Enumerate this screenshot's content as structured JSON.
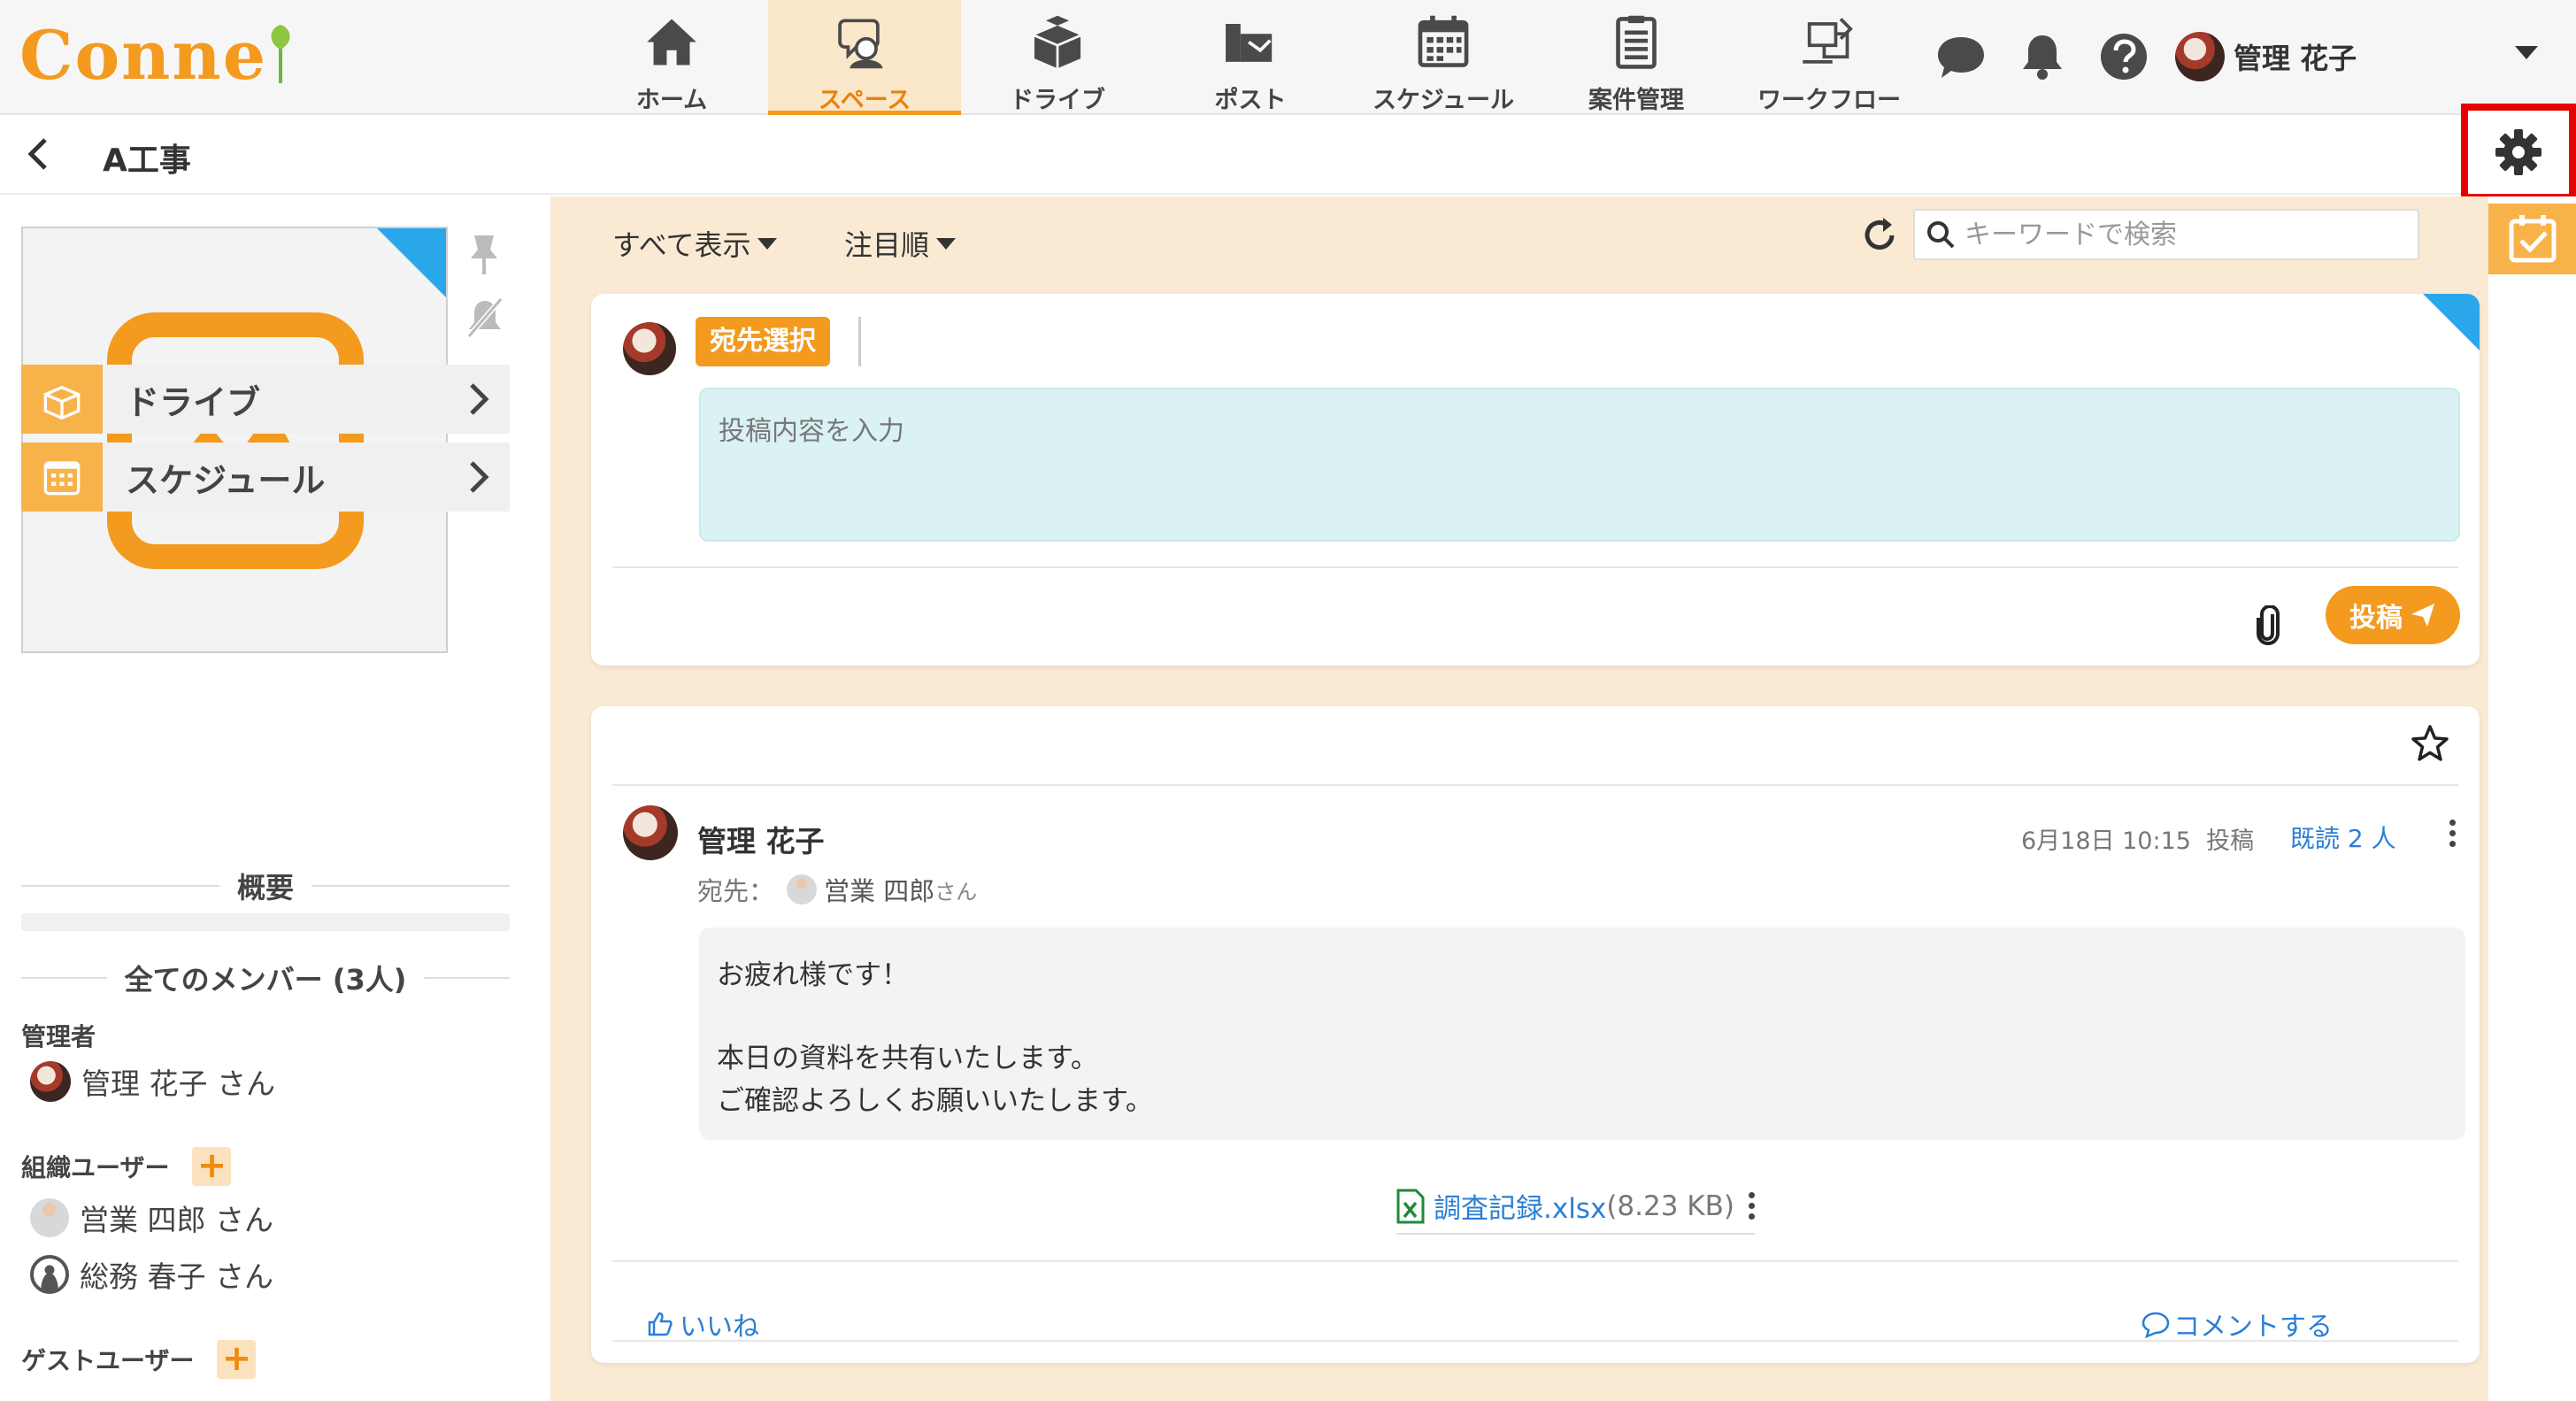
{
  "app": {
    "logo_text": "Conne"
  },
  "nav": {
    "items": [
      {
        "label": "ホーム",
        "icon": "home-icon"
      },
      {
        "label": "スペース",
        "icon": "space-icon"
      },
      {
        "label": "ドライブ",
        "icon": "drive-icon"
      },
      {
        "label": "ポスト",
        "icon": "post-icon"
      },
      {
        "label": "スケジュール",
        "icon": "calendar-icon"
      },
      {
        "label": "案件管理",
        "icon": "clipboard-icon"
      },
      {
        "label": "ワークフロー",
        "icon": "workflow-icon"
      }
    ],
    "active_index": 1
  },
  "header": {
    "user_name": "管理 花子"
  },
  "space": {
    "title": "A工事"
  },
  "left": {
    "menu": [
      {
        "label": "ドライブ",
        "icon": "drive-icon"
      },
      {
        "label": "スケジュール",
        "icon": "calendar-icon"
      }
    ],
    "summary_title": "概要",
    "members_title": "全てのメンバー (3人)",
    "roles": {
      "admin": {
        "label": "管理者",
        "members": [
          "管理 花子 さん"
        ]
      },
      "org": {
        "label": "組織ユーザー",
        "members": [
          "営業 四郎 さん",
          "総務 春子 さん"
        ]
      },
      "guest": {
        "label": "ゲストユーザー",
        "members": []
      }
    },
    "plus": "+"
  },
  "filters": {
    "display": "すべて表示",
    "sort": "注目順"
  },
  "search": {
    "placeholder": "キーワードで検索",
    "value": ""
  },
  "compose": {
    "to_button": "宛先選択",
    "placeholder": "投稿内容を入力",
    "post_button": "投稿"
  },
  "post": {
    "author": "管理 花子",
    "datetime": "6月18日 10:15",
    "posted_label": "投稿",
    "read_label": "既読 2 人",
    "to_label": "宛先：",
    "to_name": "営業 四郎",
    "to_suffix": "さん",
    "body": [
      "お疲れ様です！",
      "本日の資料を共有いたします。",
      "ご確認よろしくお願いいたします。"
    ],
    "attachment": {
      "name": "調査記録.xlsx",
      "size": "(8.23 KB)"
    },
    "like_label": "いいね",
    "comment_label": "コメントする"
  },
  "colors": {
    "accent": "#f39a1f",
    "link": "#2a7fd4",
    "highlight": "#e60000",
    "background": "#faead3"
  }
}
